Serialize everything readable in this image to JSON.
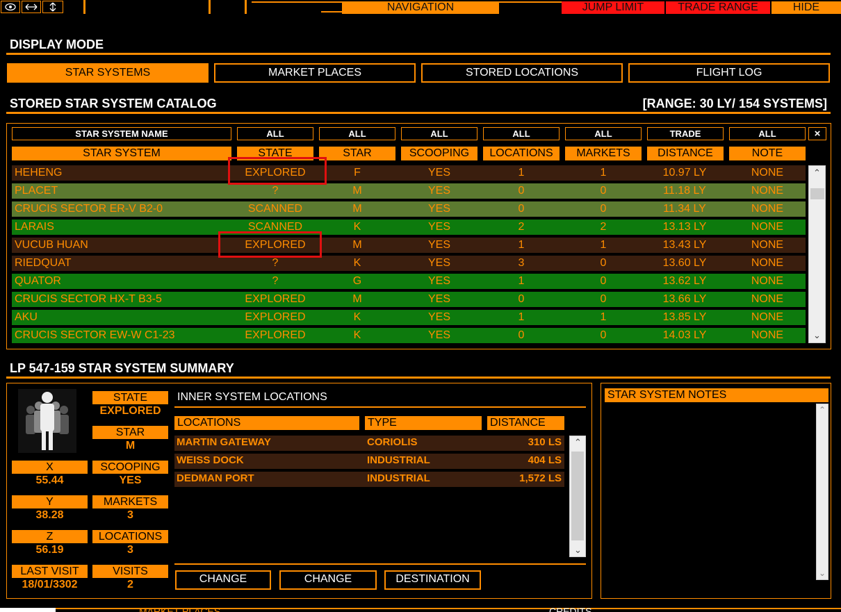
{
  "topbar": {
    "icons": [
      "eye-icon",
      "horizontal-resize-icon",
      "vertical-resize-icon"
    ],
    "navigation": "NAVIGATION",
    "jump_limit": "JUMP LIMIT",
    "trade_range": "TRADE RANGE",
    "hide": "HIDE"
  },
  "display_mode": {
    "title": "DISPLAY MODE",
    "buttons": [
      "STAR SYSTEMS",
      "MARKET PLACES",
      "STORED LOCATIONS",
      "FLIGHT LOG"
    ],
    "active": "STAR SYSTEMS"
  },
  "catalog": {
    "title": "STORED STAR SYSTEM CATALOG",
    "range": "[RANGE: 30 LY/ 154 SYSTEMS]",
    "filters": [
      "STAR SYSTEM NAME",
      "ALL",
      "ALL",
      "ALL",
      "ALL",
      "ALL",
      "TRADE",
      "ALL"
    ],
    "close": "×",
    "columns": [
      "STAR SYSTEM",
      "STATE",
      "STAR",
      "SCOOPING",
      "LOCATIONS",
      "MARKETS",
      "DISTANCE",
      "NOTE"
    ],
    "rows": [
      {
        "name": "HEHENG",
        "state": "EXPLORED",
        "star": "F",
        "scooping": "YES",
        "locations": "1",
        "markets": "1",
        "distance": "10.97 LY",
        "note": "NONE",
        "color": "#3a1e0e"
      },
      {
        "name": "PLACET",
        "state": "?",
        "star": "M",
        "scooping": "YES",
        "locations": "0",
        "markets": "0",
        "distance": "11.18 LY",
        "note": "NONE",
        "color": "#5c7a30"
      },
      {
        "name": "CRUCIS SECTOR ER-V B2-0",
        "state": "SCANNED",
        "star": "M",
        "scooping": "YES",
        "locations": "0",
        "markets": "0",
        "distance": "11.34 LY",
        "note": "NONE",
        "color": "#5c7a30"
      },
      {
        "name": "LARAIS",
        "state": "SCANNED",
        "star": "K",
        "scooping": "YES",
        "locations": "2",
        "markets": "2",
        "distance": "13.13 LY",
        "note": "NONE",
        "color": "#0d7a0d"
      },
      {
        "name": "VUCUB HUAN",
        "state": "EXPLORED",
        "star": "M",
        "scooping": "YES",
        "locations": "1",
        "markets": "1",
        "distance": "13.43 LY",
        "note": "NONE",
        "color": "#3a1e0e"
      },
      {
        "name": "RIEDQUAT",
        "state": "?",
        "star": "K",
        "scooping": "YES",
        "locations": "3",
        "markets": "0",
        "distance": "13.60 LY",
        "note": "NONE",
        "color": "#3a1e0e"
      },
      {
        "name": "QUATOR",
        "state": "?",
        "star": "G",
        "scooping": "YES",
        "locations": "1",
        "markets": "0",
        "distance": "13.62 LY",
        "note": "NONE",
        "color": "#0d7a0d"
      },
      {
        "name": "CRUCIS SECTOR HX-T B3-5",
        "state": "EXPLORED",
        "star": "M",
        "scooping": "YES",
        "locations": "0",
        "markets": "0",
        "distance": "13.66 LY",
        "note": "NONE",
        "color": "#0d7a0d"
      },
      {
        "name": "AKU",
        "state": "EXPLORED",
        "star": "K",
        "scooping": "YES",
        "locations": "1",
        "markets": "1",
        "distance": "13.85 LY",
        "note": "NONE",
        "color": "#0d7a0d"
      },
      {
        "name": "CRUCIS SECTOR EW-W C1-23",
        "state": "EXPLORED",
        "star": "K",
        "scooping": "YES",
        "locations": "0",
        "markets": "0",
        "distance": "14.03 LY",
        "note": "NONE",
        "color": "#0d7a0d"
      }
    ]
  },
  "summary": {
    "title": "LP 547-159 STAR SYSTEM SUMMARY",
    "state_label": "STATE",
    "state": "EXPLORED",
    "star_label": "STAR",
    "star": "M",
    "x_label": "X",
    "x": "55.44",
    "scooping_label": "SCOOPING",
    "scooping": "YES",
    "y_label": "Y",
    "y": "38.28",
    "markets_label": "MARKETS",
    "markets": "3",
    "z_label": "Z",
    "z": "56.19",
    "locations_label": "LOCATIONS",
    "locations": "3",
    "last_visit_label": "LAST VISIT",
    "last_visit": "18/01/3302",
    "visits_label": "VISITS",
    "visits": "2",
    "inner_title": "INNER SYSTEM LOCATIONS",
    "loc_columns": [
      "LOCATIONS",
      "TYPE",
      "DISTANCE"
    ],
    "loc_rows": [
      {
        "name": "MARTIN GATEWAY",
        "type": "CORIOLIS",
        "distance": "310 LS"
      },
      {
        "name": "WEISS DOCK",
        "type": "INDUSTRIAL",
        "distance": "404 LS"
      },
      {
        "name": "DEDMAN PORT",
        "type": "INDUSTRIAL",
        "distance": "1,572 LS"
      }
    ],
    "buttons": [
      "CHANGE",
      "CHANGE",
      "DESTINATION"
    ],
    "notes_title": "STAR SYSTEM NOTES"
  },
  "bottombar": {
    "left": "MARKET PLACES",
    "right": "CREDITS"
  }
}
